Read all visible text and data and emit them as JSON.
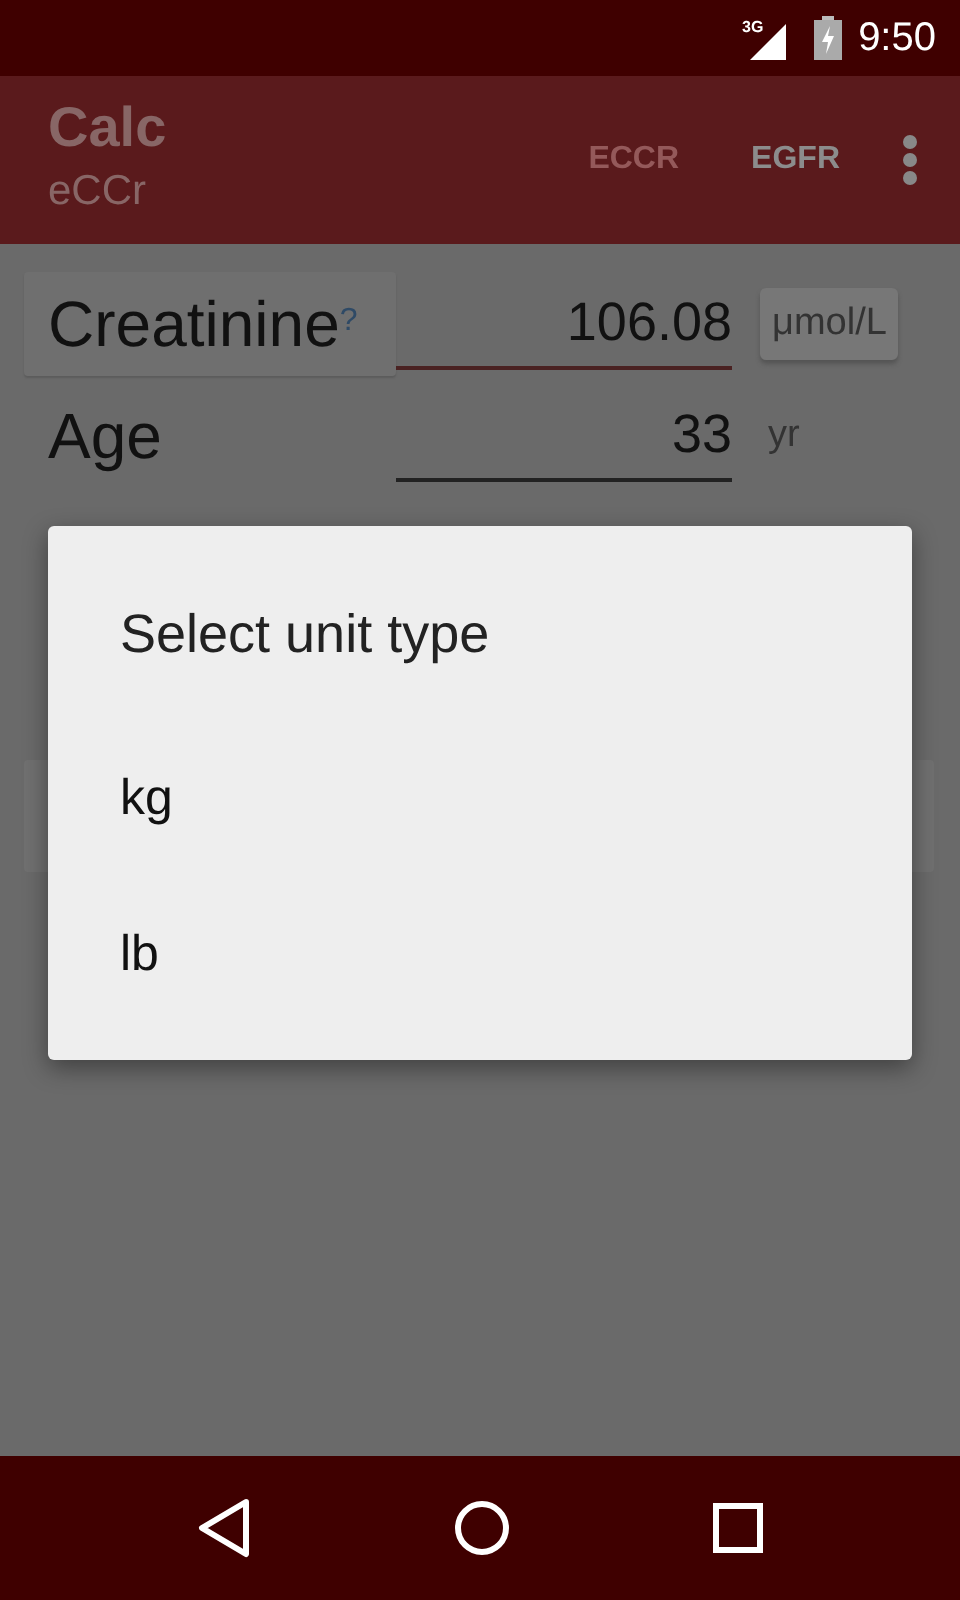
{
  "status_bar": {
    "network": "3G",
    "time": "9:50"
  },
  "toolbar": {
    "title": "Calc",
    "subtitle": "eCCr",
    "tabs": [
      {
        "label": "ECCR",
        "selected": false
      },
      {
        "label": "EGFR",
        "selected": true
      }
    ]
  },
  "fields": [
    {
      "label": "Creatinine",
      "hint": "?",
      "value": "106.08",
      "unit": "μmol/L",
      "kind": "button",
      "focused": true
    },
    {
      "label": "Age",
      "value": "33",
      "unit": "yr",
      "kind": "text",
      "focused": false
    }
  ],
  "dialog": {
    "title": "Select unit type",
    "options": [
      "kg",
      "lb"
    ]
  }
}
